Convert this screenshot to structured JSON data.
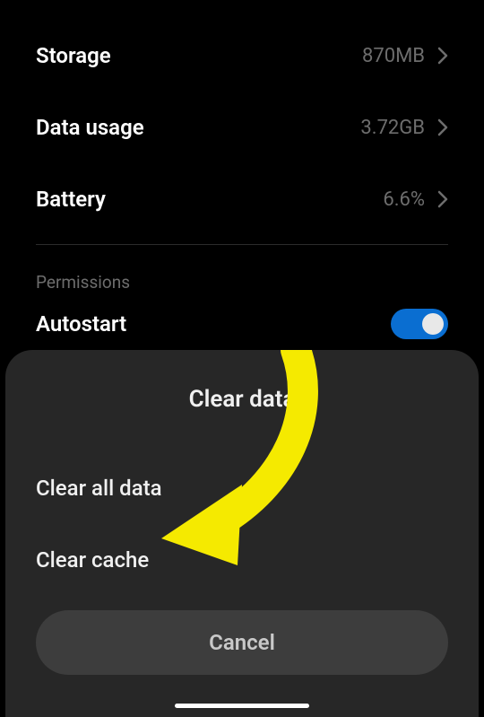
{
  "rows": {
    "storage": {
      "label": "Storage",
      "value": "870MB"
    },
    "data_usage": {
      "label": "Data usage",
      "value": "3.72GB"
    },
    "battery": {
      "label": "Battery",
      "value": "6.6%"
    }
  },
  "section": {
    "header": "Permissions"
  },
  "autostart": {
    "label": "Autostart",
    "enabled": true
  },
  "sheet": {
    "title": "Clear data",
    "option_all": "Clear all data",
    "option_cache": "Clear cache",
    "cancel": "Cancel"
  }
}
